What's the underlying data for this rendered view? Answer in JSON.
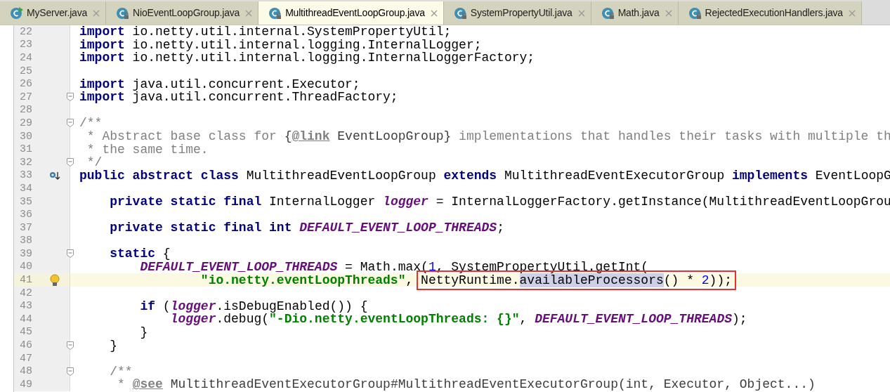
{
  "tabs": [
    {
      "label": "MyServer.java",
      "kind": "runnable",
      "selected": false
    },
    {
      "label": "NioEventLoopGroup.java",
      "kind": "locked",
      "selected": false
    },
    {
      "label": "MultithreadEventLoopGroup.java",
      "kind": "locked",
      "selected": true
    },
    {
      "label": "SystemPropertyUtil.java",
      "kind": "locked",
      "selected": false
    },
    {
      "label": "Math.java",
      "kind": "locked",
      "selected": false
    },
    {
      "label": "RejectedExecutionHandlers.java",
      "kind": "locked",
      "selected": false
    }
  ],
  "editor": {
    "lines": [
      {
        "number": "22",
        "tokens": [
          {
            "kind": "kw",
            "text": "import"
          },
          {
            "kind": "plain",
            "text": " io.netty.util.internal.SystemPropertyUtil;"
          }
        ]
      },
      {
        "number": "23",
        "tokens": [
          {
            "kind": "kw",
            "text": "import"
          },
          {
            "kind": "plain",
            "text": " io.netty.util.internal.logging.InternalLogger;"
          }
        ]
      },
      {
        "number": "24",
        "tokens": [
          {
            "kind": "kw",
            "text": "import"
          },
          {
            "kind": "plain",
            "text": " io.netty.util.internal.logging.InternalLoggerFactory;"
          }
        ]
      },
      {
        "number": "25"
      },
      {
        "number": "26",
        "tokens": [
          {
            "kind": "kw",
            "text": "import"
          },
          {
            "kind": "plain",
            "text": " java.util.concurrent.Executor;"
          }
        ]
      },
      {
        "number": "27",
        "fold": true,
        "tokens": [
          {
            "kind": "kw",
            "text": "import"
          },
          {
            "kind": "plain",
            "text": " java.util.concurrent.ThreadFactory;"
          }
        ]
      },
      {
        "number": "28"
      },
      {
        "number": "29",
        "fold": true,
        "tokens": [
          {
            "kind": "doc",
            "text": "/**"
          }
        ]
      },
      {
        "number": "30",
        "tokens": [
          {
            "kind": "doc",
            "text": " * Abstract base class for "
          },
          {
            "kind": "docref",
            "text": "{"
          },
          {
            "kind": "doctag",
            "text": "@link"
          },
          {
            "kind": "docref",
            "text": " EventLoopGroup}"
          },
          {
            "kind": "doc",
            "text": " implementations that handles their tasks with multiple th"
          }
        ]
      },
      {
        "number": "31",
        "tokens": [
          {
            "kind": "doc",
            "text": " * the same time."
          }
        ]
      },
      {
        "number": "32",
        "fold": true,
        "tokens": [
          {
            "kind": "doc",
            "text": " */"
          }
        ]
      },
      {
        "number": "33",
        "gutter_marker": {
          "kind": "override"
        },
        "tokens": [
          {
            "kind": "kw",
            "text": "public abstract class"
          },
          {
            "kind": "plain",
            "text": " MultithreadEventLoopGroup "
          },
          {
            "kind": "kw",
            "text": "extends"
          },
          {
            "kind": "plain",
            "text": " MultithreadEventExecutorGroup "
          },
          {
            "kind": "kw",
            "text": "implements"
          },
          {
            "kind": "plain",
            "text": " EventLoopG"
          }
        ]
      },
      {
        "number": "34"
      },
      {
        "number": "35",
        "tokens": [
          {
            "kind": "kw",
            "text": "    private static final"
          },
          {
            "kind": "plain",
            "text": " InternalLogger "
          },
          {
            "kind": "field",
            "text": "logger"
          },
          {
            "kind": "plain",
            "text": " = InternalLoggerFactory.getInstance(MultithreadEventLoopGrou"
          }
        ]
      },
      {
        "number": "36"
      },
      {
        "number": "37",
        "tokens": [
          {
            "kind": "kw",
            "text": "    private static final int "
          },
          {
            "kind": "field",
            "text": "DEFAULT_EVENT_LOOP_THREADS"
          },
          {
            "kind": "plain",
            "text": ";"
          }
        ]
      },
      {
        "number": "38"
      },
      {
        "number": "39",
        "fold": true,
        "tokens": [
          {
            "kind": "kw",
            "text": "    static"
          },
          {
            "kind": "plain",
            "text": " {"
          }
        ]
      },
      {
        "number": "40",
        "tokens": [
          {
            "kind": "field",
            "text": "        DEFAULT_EVENT_LOOP_THREADS"
          },
          {
            "kind": "plain",
            "text": " = Math.max("
          },
          {
            "kind": "num",
            "text": "1"
          },
          {
            "kind": "plain",
            "text": ", SystemPropertyUtil.getInt("
          }
        ]
      },
      {
        "number": "41",
        "current": true,
        "gutter_marker": {
          "kind": "bulb"
        },
        "tokens": [
          {
            "kind": "str",
            "text": "                \"io.netty.eventLoopThreads\""
          },
          {
            "kind": "plain",
            "text": ", "
          }
        ],
        "boxed_tokens": [
          {
            "kind": "plain",
            "text": "NettyRuntime."
          },
          {
            "kind": "selection",
            "text": "availableProcessors"
          },
          {
            "kind": "plain",
            "text": "() * "
          },
          {
            "kind": "num",
            "text": "2"
          },
          {
            "kind": "plain",
            "text": "));"
          }
        ]
      },
      {
        "number": "42"
      },
      {
        "number": "43",
        "tokens": [
          {
            "kind": "kw",
            "text": "        if"
          },
          {
            "kind": "plain",
            "text": " ("
          },
          {
            "kind": "field",
            "text": "logger"
          },
          {
            "kind": "plain",
            "text": ".isDebugEnabled()) {"
          }
        ]
      },
      {
        "number": "44",
        "tokens": [
          {
            "kind": "field",
            "text": "            logger"
          },
          {
            "kind": "plain",
            "text": ".debug("
          },
          {
            "kind": "str",
            "text": "\"-Dio.netty.eventLoopThreads: {}\""
          },
          {
            "kind": "plain",
            "text": ", "
          },
          {
            "kind": "field",
            "text": "DEFAULT_EVENT_LOOP_THREADS"
          },
          {
            "kind": "plain",
            "text": ");"
          }
        ]
      },
      {
        "number": "45",
        "tokens": [
          {
            "kind": "plain",
            "text": "        }"
          }
        ]
      },
      {
        "number": "46",
        "fold": true,
        "tokens": [
          {
            "kind": "plain",
            "text": "    }"
          }
        ]
      },
      {
        "number": "47"
      },
      {
        "number": "48",
        "fold": true,
        "tokens": [
          {
            "kind": "doc",
            "text": "    /**"
          }
        ]
      },
      {
        "number": "49",
        "tokens": [
          {
            "kind": "doc",
            "text": "     * "
          },
          {
            "kind": "doctag",
            "text": "@see"
          },
          {
            "kind": "docref",
            "text": " MultithreadEventExecutorGroup#MultithreadEventExecutorGroup(int, Executor, Object...)"
          }
        ]
      }
    ]
  }
}
